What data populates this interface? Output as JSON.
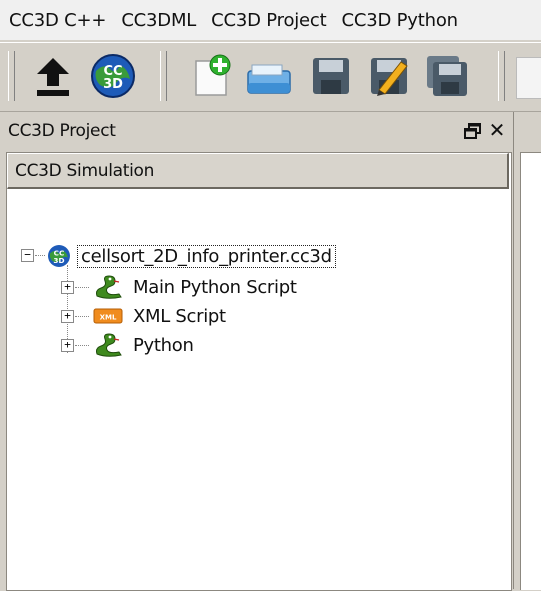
{
  "menubar": {
    "items": [
      "CC3D C++",
      "CC3DML",
      "CC3D Project",
      "CC3D Python"
    ]
  },
  "toolbar": {
    "buttons": [
      {
        "icon": "upload-arrow-icon"
      },
      {
        "icon": "cc3d-globe-icon"
      },
      {
        "icon": "new-file-icon"
      },
      {
        "icon": "open-folder-icon"
      },
      {
        "icon": "save-icon"
      },
      {
        "icon": "save-as-icon"
      },
      {
        "icon": "save-all-icon"
      }
    ]
  },
  "dock": {
    "title": "CC3D Project",
    "float_glyph": "🗗",
    "close_glyph": "✕"
  },
  "tree": {
    "header": "CC3D Simulation",
    "root": {
      "label": "cellsort_2D_info_printer.cc3d",
      "icon": "cc3d-globe-icon"
    },
    "children": [
      {
        "label": "Main Python Script",
        "icon": "python-snake-icon"
      },
      {
        "label": "XML Script",
        "icon": "xml-file-icon"
      },
      {
        "label": "Python",
        "icon": "python-snake-icon"
      }
    ]
  },
  "colors": {
    "window_bg": "#d4d0c8",
    "menubar_bg": "#f0f0f0",
    "tree_bg": "#ffffff",
    "header_bg": "#d8d4cc"
  }
}
